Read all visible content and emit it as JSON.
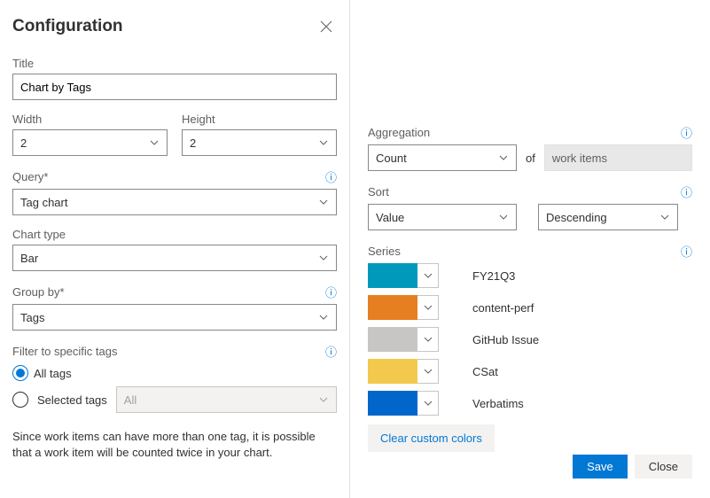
{
  "header": {
    "title": "Configuration"
  },
  "left": {
    "title_label": "Title",
    "title_value": "Chart by Tags",
    "width_label": "Width",
    "width_value": "2",
    "height_label": "Height",
    "height_value": "2",
    "query_label": "Query*",
    "query_value": "Tag chart",
    "chart_type_label": "Chart type",
    "chart_type_value": "Bar",
    "group_by_label": "Group by*",
    "group_by_value": "Tags",
    "filter_label": "Filter to specific tags",
    "radio_all": "All tags",
    "radio_selected": "Selected tags",
    "tags_dropdown": "All",
    "note": "Since work items can have more than one tag, it is possible that a work item will be counted twice in your chart."
  },
  "right": {
    "agg_label": "Aggregation",
    "agg_value": "Count",
    "of_label": "of",
    "of_value": "work items",
    "sort_label": "Sort",
    "sort_by": "Value",
    "sort_dir": "Descending",
    "series_label": "Series",
    "series": [
      {
        "color": "#0099bc",
        "label": "FY21Q3"
      },
      {
        "color": "#e67e22",
        "label": "content-perf"
      },
      {
        "color": "#c8c6c4",
        "label": "GitHub Issue"
      },
      {
        "color": "#f2c94c",
        "label": "CSat"
      },
      {
        "color": "#0066cc",
        "label": "Verbatims"
      }
    ],
    "clear_label": "Clear custom colors",
    "save": "Save",
    "close": "Close"
  }
}
